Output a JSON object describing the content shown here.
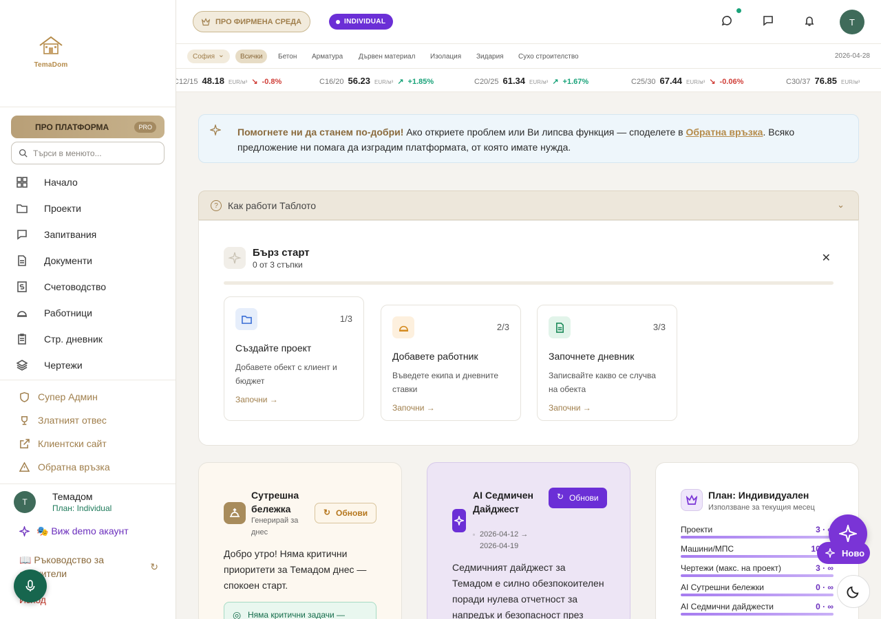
{
  "logo": {
    "text": "TemaDom"
  },
  "sidebar": {
    "pro_label": "ПРО ПЛАТФОРМА",
    "pro_badge": "PRO",
    "search_placeholder": "Търси в менюто...",
    "items": [
      {
        "label": "Начало",
        "icon": "grid-icon"
      },
      {
        "label": "Проекти",
        "icon": "folder-icon"
      },
      {
        "label": "Запитвания",
        "icon": "chat-icon"
      },
      {
        "label": "Документи",
        "icon": "document-icon"
      },
      {
        "label": "Счетоводство",
        "icon": "dollar-icon"
      },
      {
        "label": "Работници",
        "icon": "hardhat-icon"
      },
      {
        "label": "Стр. дневник",
        "icon": "clipboard-icon"
      },
      {
        "label": "Чертежи",
        "icon": "layers-icon"
      }
    ],
    "admin_items": [
      {
        "label": "Супер Админ",
        "icon": "shield-icon"
      },
      {
        "label": "Златният отвес",
        "icon": "trophy-icon"
      },
      {
        "label": "Клиентски сайт",
        "icon": "external-link-icon"
      },
      {
        "label": "Обратна връзка",
        "icon": "warning-icon"
      }
    ],
    "user": {
      "initial": "T",
      "name": "Темадом",
      "plan": "План: Individual"
    },
    "demo_link": "🎭 Виж demo акаунт",
    "guide_link": "📖 Ръководство за служители",
    "logout": "Изход"
  },
  "header": {
    "pro_pill": "ПРО ФИРМЕНА СРЕДА",
    "plan_pill": "INDIVIDUAL",
    "avatar": "T"
  },
  "filter": {
    "city": "София",
    "categories": [
      "Всички",
      "Бетон",
      "Арматура",
      "Дървен материал",
      "Изолация",
      "Зидария",
      "Сухо строителство"
    ],
    "active_category": "Всички",
    "date": "2026-04-28"
  },
  "ticker": [
    {
      "grade": "C12/15",
      "price": "48.18",
      "unit": "EUR/м³",
      "change": "-0.8%",
      "dir": "down"
    },
    {
      "grade": "C16/20",
      "price": "56.23",
      "unit": "EUR/м³",
      "change": "+1.85%",
      "dir": "up"
    },
    {
      "grade": "C20/25",
      "price": "61.34",
      "unit": "EUR/м³",
      "change": "+1.67%",
      "dir": "up"
    },
    {
      "grade": "C25/30",
      "price": "67.44",
      "unit": "EUR/м³",
      "change": "-0.06%",
      "dir": "down"
    },
    {
      "grade": "C30/37",
      "price": "76.85",
      "unit": "EUR/м³",
      "change": "",
      "dir": ""
    }
  ],
  "feedback": {
    "bold": "Помогнете ни да станем по-добри!",
    "text1": " Ако откриете проблем или Ви липсва функция — споделете в ",
    "link": "Обратна връзка",
    "text2": ". Всяко предложение ни помага да изградим платформата, от която имате нужда."
  },
  "howto": {
    "label": "Как работи Таблото"
  },
  "quickstart": {
    "title": "Бърз старт",
    "progress": "0 от 3 стъпки",
    "steps": [
      {
        "num": "1/3",
        "title": "Създайте проект",
        "desc": "Добавете обект с клиент и бюджет",
        "cta": "Започни →"
      },
      {
        "num": "2/3",
        "title": "Добавете работник",
        "desc": "Въведете екипа и дневните ставки",
        "cta": "Започни →"
      },
      {
        "num": "3/3",
        "title": "Започнете дневник",
        "desc": "Записвайте какво се случва на обекта",
        "cta": "Започни →"
      }
    ]
  },
  "morning": {
    "title": "Сутрешна бележка",
    "subtitle": "Генерирай за днес",
    "refresh": "Обнови",
    "text": "Добро утро! Няма критични приоритети за Темадом днес — спокоен старт.",
    "ok": "Няма критични задачи —"
  },
  "digest": {
    "title": "AI Седмичен Дайджест",
    "range": "2026-04-12 → 2026-04-19",
    "refresh": "Обнови",
    "text": "Седмичният дайджест за Темадом е силно обезпокоителен поради нулева отчетност за напредък и безопасност през"
  },
  "plan": {
    "title": "План: Индивидуален",
    "subtitle": "Използване за текущия месец",
    "rows": [
      {
        "label": "Проекти",
        "value": "3 · ∞"
      },
      {
        "label": "Машини/МПС",
        "value": "10 · ∞"
      },
      {
        "label": "Чертежи (макс. на проект)",
        "value": "3 · ∞"
      },
      {
        "label": "AI Сутрешни бележки",
        "value": "0 · ∞"
      },
      {
        "label": "AI Седмични дайджести",
        "value": "0 · ∞"
      }
    ]
  },
  "fab": {
    "new_label": "Ново"
  }
}
